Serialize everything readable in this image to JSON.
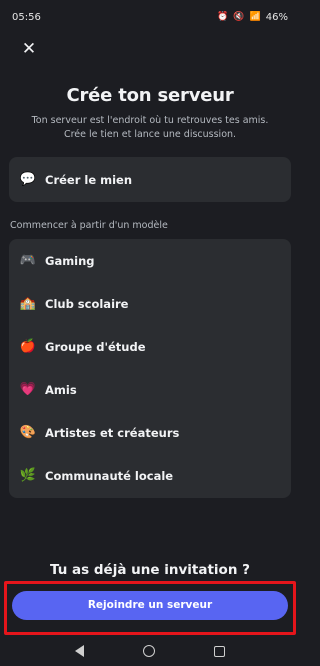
{
  "status": {
    "time": "05:56",
    "battery": "46%"
  },
  "header": {
    "close_icon": "close-icon",
    "title": "Crée ton serveur",
    "subtitle_line1": "Ton serveur est l'endroit où tu retrouves tes amis.",
    "subtitle_line2": "Crée le tien et lance une discussion."
  },
  "create": {
    "label": "Créer le mien",
    "icon": "create-server-icon"
  },
  "templates": {
    "section_label": "Commencer à partir d'un modèle",
    "items": [
      {
        "label": "Gaming",
        "icon": "gamepad-icon",
        "glyph": "🎮"
      },
      {
        "label": "Club scolaire",
        "icon": "school-icon",
        "glyph": "🏫"
      },
      {
        "label": "Groupe d'étude",
        "icon": "apple-icon",
        "glyph": "🍎"
      },
      {
        "label": "Amis",
        "icon": "heart-icon",
        "glyph": "💗"
      },
      {
        "label": "Artistes et créateurs",
        "icon": "palette-icon",
        "glyph": "🎨"
      },
      {
        "label": "Communauté locale",
        "icon": "leaf-icon",
        "glyph": "🌿"
      }
    ]
  },
  "invite": {
    "question": "Tu as déjà une invitation ?",
    "button_label": "Rejoindre un serveur"
  },
  "colors": {
    "background": "#1c1d22",
    "card": "#2b2d31",
    "accent": "#5865f2",
    "highlight": "#e5151b"
  }
}
